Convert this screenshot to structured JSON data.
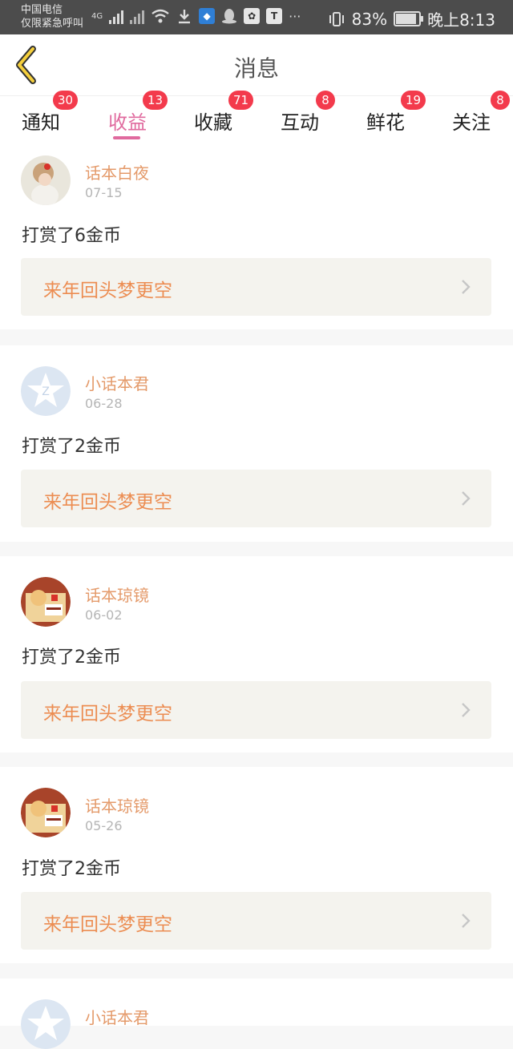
{
  "status": {
    "carrier_line1": "中国电信",
    "carrier_line2": "仅限紧急呼叫",
    "network": "4G",
    "battery": "83%",
    "battery_level": 0.83,
    "time": "晚上8:13"
  },
  "header": {
    "title": "消息"
  },
  "tabs": [
    {
      "label": "通知",
      "badge": "30"
    },
    {
      "label": "收益",
      "badge": "13",
      "active": true
    },
    {
      "label": "收藏",
      "badge": "71"
    },
    {
      "label": "互动",
      "badge": "8"
    },
    {
      "label": "鲜花",
      "badge": "19"
    },
    {
      "label": "关注",
      "badge": "8"
    }
  ],
  "messages": [
    {
      "user": "话本白夜",
      "date": "07-15",
      "text": "打赏了6金币",
      "ref": "来年回头梦更空",
      "avatar": "photo-girl-avatar"
    },
    {
      "user": "小话本君",
      "date": "06-28",
      "text": "打赏了2金币",
      "ref": "来年回头梦更空",
      "avatar": "default-star-avatar"
    },
    {
      "user": "话本琼镜",
      "date": "06-02",
      "text": "打赏了2金币",
      "ref": "来年回头梦更空",
      "avatar": "illustration-avatar"
    },
    {
      "user": "话本琼镜",
      "date": "05-26",
      "text": "打赏了2金币",
      "ref": "来年回头梦更空",
      "avatar": "illustration-avatar"
    },
    {
      "user": "小话本君",
      "date": "",
      "text": "",
      "ref": "",
      "avatar": "default-star-avatar"
    }
  ],
  "colors": {
    "accent_pink": "#e06a9e",
    "badge_red": "#f33a4c",
    "username_orange": "#e49a6a",
    "ref_orange": "#ec8d52"
  }
}
